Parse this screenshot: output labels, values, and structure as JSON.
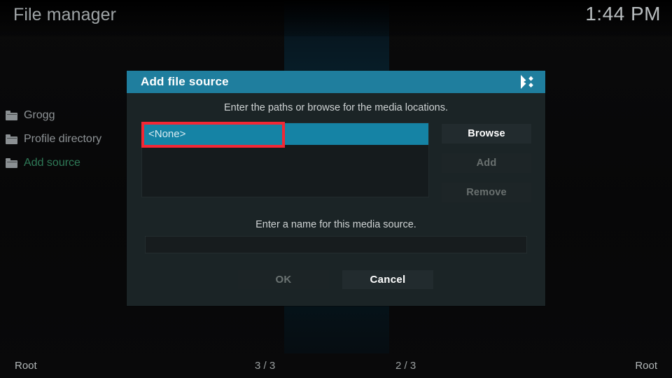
{
  "window": {
    "app_title": "File manager",
    "clock": "1:44 PM"
  },
  "sidebar": {
    "items": [
      {
        "label": "Grogg",
        "icon": "folder-icon",
        "selected": false
      },
      {
        "label": "Profile directory",
        "icon": "folder-icon",
        "selected": false
      },
      {
        "label": "Add source",
        "icon": "folder-icon",
        "selected": true
      }
    ]
  },
  "dialog": {
    "title": "Add file source",
    "logo_icon": "kodi-logo-icon",
    "hint_paths": "Enter the paths or browse for the media locations.",
    "hint_name": "Enter a name for this media source.",
    "path_list": {
      "rows": [
        {
          "label": "<None>",
          "selected": true
        }
      ]
    },
    "name_field": {
      "value": "",
      "placeholder": ""
    },
    "side_buttons": [
      {
        "label": "Browse",
        "enabled": true
      },
      {
        "label": "Add",
        "enabled": false
      },
      {
        "label": "Remove",
        "enabled": false
      }
    ],
    "footer_buttons": [
      {
        "label": "OK",
        "enabled": false
      },
      {
        "label": "Cancel",
        "enabled": true
      }
    ]
  },
  "annotation": {
    "shape": "rectangle",
    "color": "#f32735",
    "target": "<None>"
  },
  "statusbar": {
    "left": "Root",
    "count_left": "3 / 3",
    "count_right": "2 / 3",
    "right": "Root"
  },
  "colors": {
    "header_teal": "#1f7e9e",
    "row_selected": "#1583a5",
    "dialog_bg": "#1b2426",
    "accent_green": "#2f7a57",
    "annotation_red": "#f32735"
  }
}
